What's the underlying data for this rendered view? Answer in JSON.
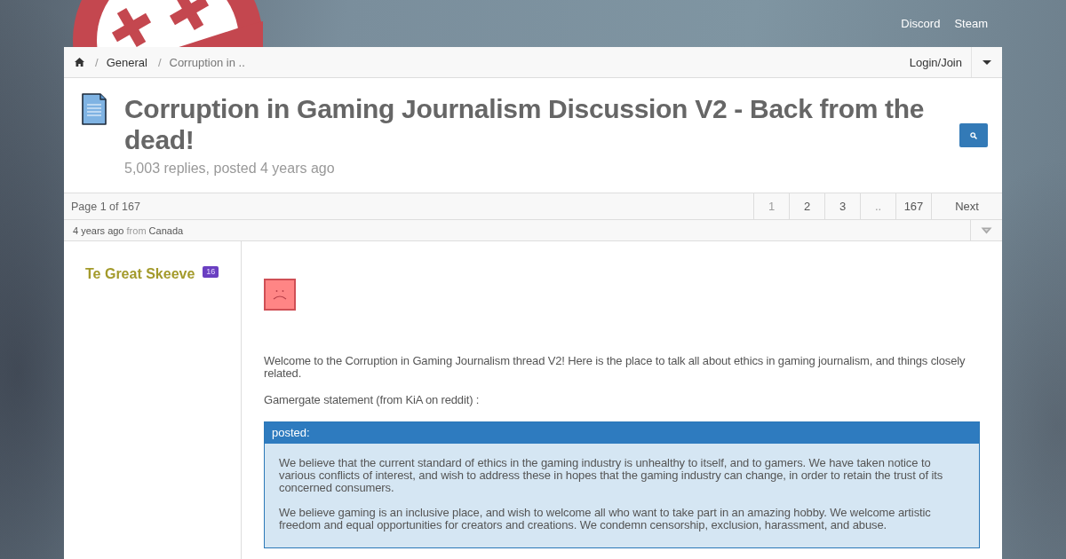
{
  "top_nav": {
    "links": [
      "Discord",
      "Steam"
    ]
  },
  "breadcrumb": {
    "separator": "/",
    "items": [
      {
        "label": "General",
        "current": false
      },
      {
        "label": "Corruption in ..",
        "current": true
      }
    ]
  },
  "account": {
    "login_label": "Login/Join"
  },
  "thread": {
    "title": "Corruption in Gaming Journalism Discussion V2 - Back from the dead!",
    "subtitle": "5,003 replies, posted 4 years ago"
  },
  "pagination": {
    "summary": "Page 1 of 167",
    "pages": [
      {
        "label": "1",
        "disabled": true
      },
      {
        "label": "2",
        "disabled": false
      },
      {
        "label": "3",
        "disabled": false
      },
      {
        "label": "..",
        "disabled": true
      },
      {
        "label": "167",
        "disabled": false
      }
    ],
    "next": "Next"
  },
  "post": {
    "meta": {
      "time": "4 years ago",
      "from_label": "from",
      "location": "Canada"
    },
    "author": {
      "name": "Te Great Skeeve",
      "badge": "16"
    },
    "paragraphs": [
      "Welcome to the Corruption in Gaming Journalism thread V2! Here is the place to talk all about ethics in gaming journalism, and things closely related.",
      "Gamergate statement (from KiA on reddit) :"
    ],
    "quote": {
      "header": "posted:",
      "paragraphs": [
        "We believe that the current standard of ethics in the gaming industry is unhealthy to itself, and to gamers. We have taken notice to various conflicts of interest, and wish to address these in hopes that the gaming industry can change, in order to retain the trust of its concerned consumers.",
        "We believe gaming is an inclusive place, and wish to welcome all who want to take part in an amazing hobby. We welcome artistic freedom and equal opportunities for creators and creations. We condemn censorship, exclusion, harassment, and abuse."
      ]
    }
  }
}
